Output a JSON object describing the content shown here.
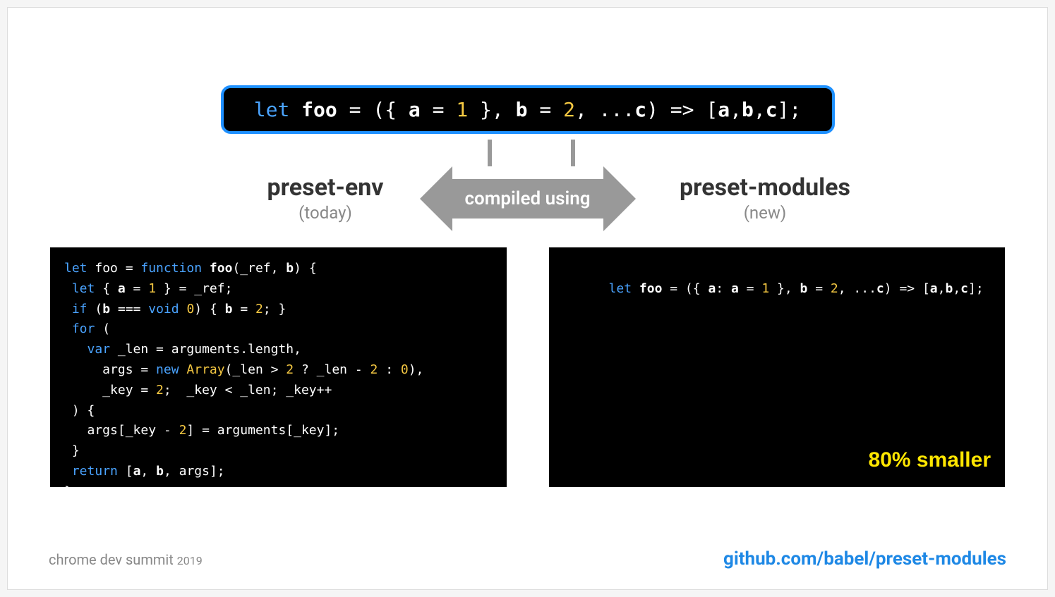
{
  "top_code_html": "<span class='kw'>let</span> <span class='id'>foo</span> = ({ <span class='id'>a</span> = <span class='num'>1</span> }, <span class='id'>b</span> = <span class='num'>2</span>, ...<span class='id'>c</span>) =&gt; [<span class='id'>a</span>,<span class='id'>b</span>,<span class='id'>c</span>];",
  "arrow_label": "compiled using",
  "left": {
    "title": "preset-env",
    "sub": "(today)",
    "code_html": "<span class='kw'>let</span> foo = <span class='kw'>function</span> <span class='id'>foo</span>(_ref, <span class='id'>b</span>) {\n <span class='kw'>let</span> { <span class='id'>a</span> = <span class='num'>1</span> } = _ref;\n <span class='kw'>if</span> (<span class='id'>b</span> === <span class='kw'>void</span> <span class='num'>0</span>) { <span class='id'>b</span> = <span class='num'>2</span>; }\n <span class='kw'>for</span> (\n   <span class='kw'>var</span> _len = arguments.length,\n     args = <span class='kw'>new</span> <span class='num'>Array</span>(_len &gt; <span class='num'>2</span> ? _len - <span class='num'>2</span> : <span class='num'>0</span>),\n     _key = <span class='num'>2</span>;  _key &lt; _len; _key++\n ) {\n   args[_key - <span class='num'>2</span>] = arguments[_key];\n }\n <span class='kw'>return</span> [<span class='id'>a</span>, <span class='id'>b</span>, args];\n};"
  },
  "right": {
    "title": "preset-modules",
    "sub": "(new)",
    "code_html": "<span class='kw'>let</span> <span class='id'>foo</span> = ({ <span class='id'>a</span>: <span class='id'>a</span> = <span class='num'>1</span> }, <span class='id'>b</span> = <span class='num'>2</span>, ...<span class='id'>c</span>) =&gt; [<span class='id'>a</span>,<span class='id'>b</span>,<span class='id'>c</span>];",
    "badge": "80% smaller"
  },
  "footer": {
    "event": "chrome dev summit",
    "year": "2019",
    "link": "github.com/babel/preset-modules"
  }
}
